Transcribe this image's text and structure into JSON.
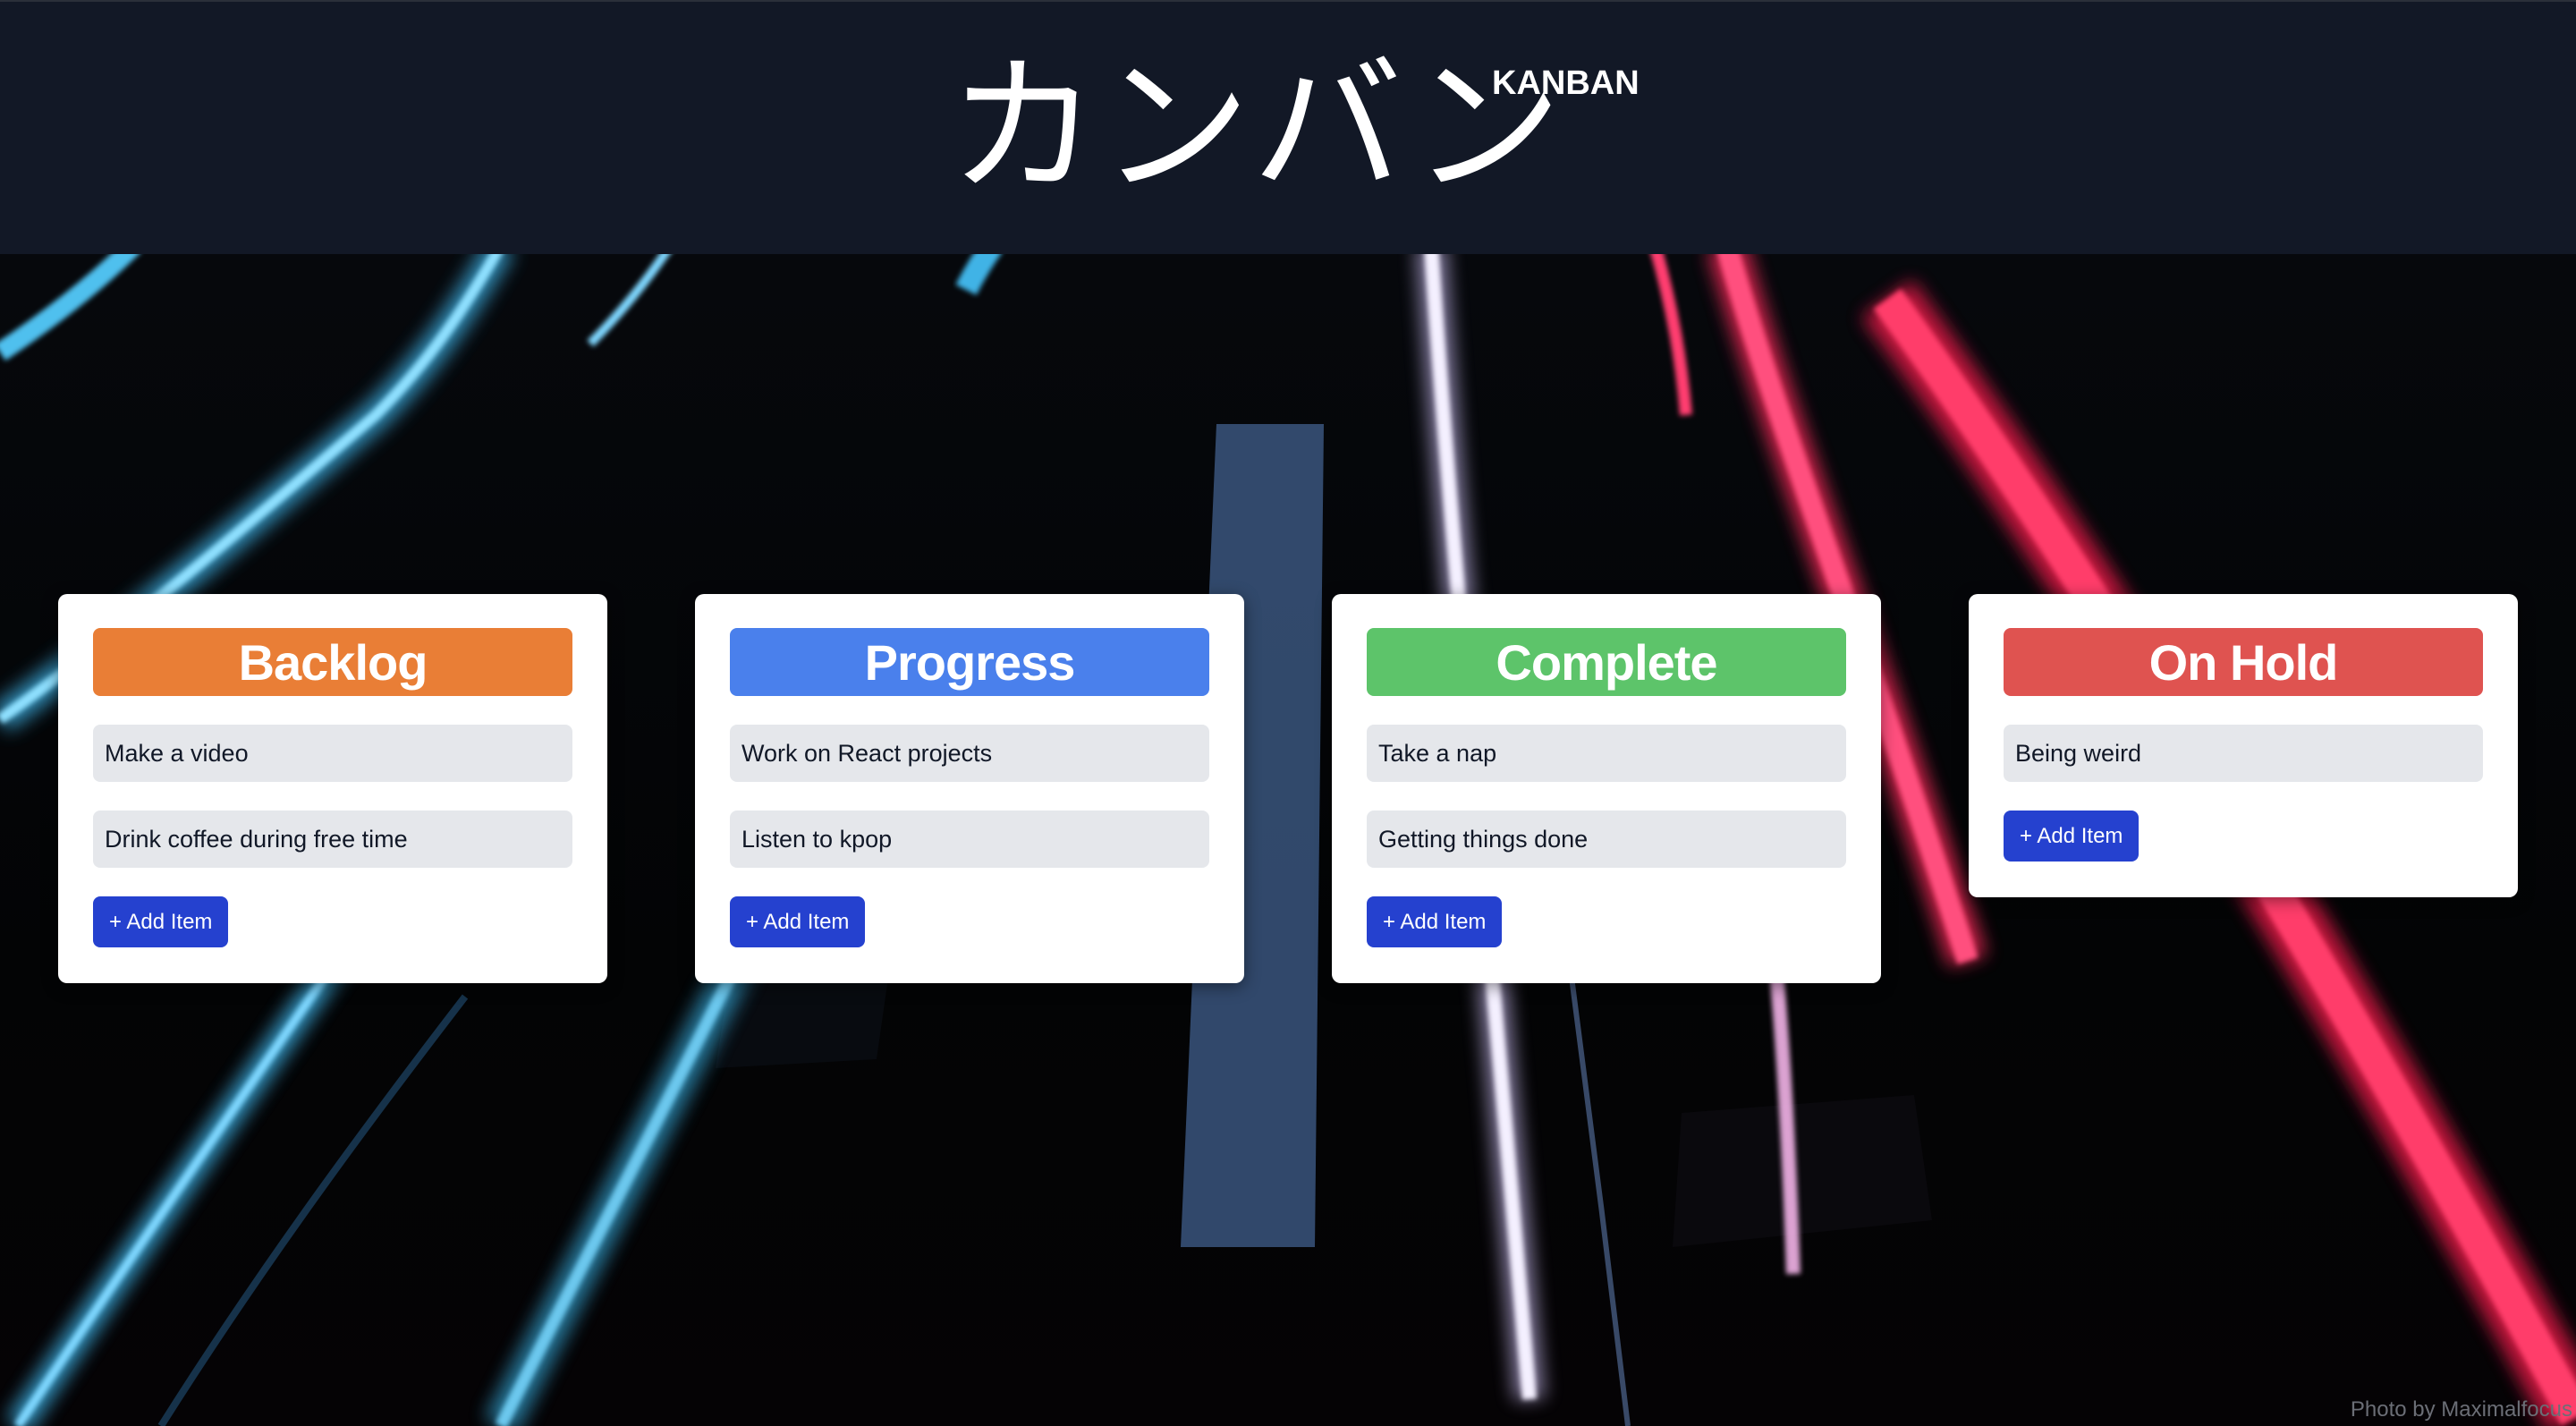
{
  "header": {
    "title": "カンバン",
    "subtitle": "KANBAN"
  },
  "columns": [
    {
      "title": "Backlog",
      "color": "#e97e36",
      "items": [
        "Make a video",
        "Drink coffee during free time"
      ],
      "add_label": "+ Add Item"
    },
    {
      "title": "Progress",
      "color": "#4a80ec",
      "items": [
        "Work on React projects",
        "Listen to kpop"
      ],
      "add_label": "+ Add Item"
    },
    {
      "title": "Complete",
      "color": "#5dc46a",
      "items": [
        "Take a nap",
        "Getting things done"
      ],
      "add_label": "+ Add Item"
    },
    {
      "title": "On Hold",
      "color": "#df5350",
      "items": [
        "Being weird"
      ],
      "add_label": "+ Add Item"
    }
  ],
  "background": {
    "credit": "Photo by Maximalfocus"
  },
  "colors": {
    "header_bg": "#121826",
    "button_bg": "#2541cf",
    "item_bg": "#e5e7eb"
  }
}
